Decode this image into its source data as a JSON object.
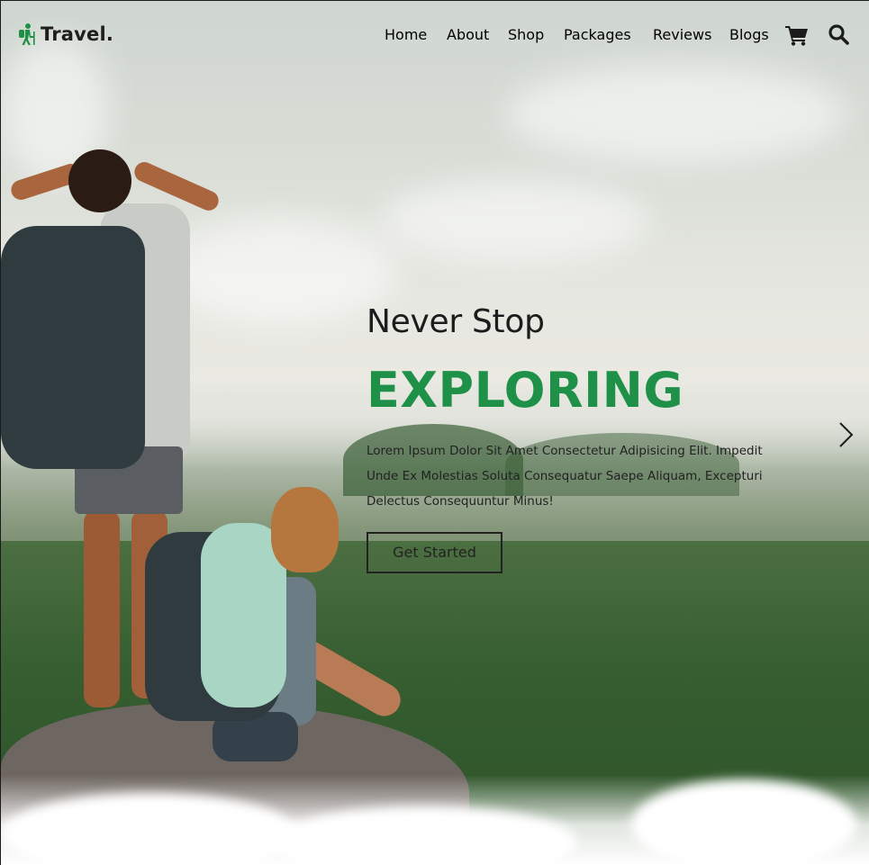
{
  "header": {
    "logo_text": "Travel.",
    "nav": [
      {
        "label": "Home"
      },
      {
        "label": "About"
      },
      {
        "label": "Shop"
      },
      {
        "label": "Packages"
      },
      {
        "label": "Reviews"
      },
      {
        "label": "Blogs"
      }
    ],
    "icons": [
      "cart-icon",
      "search-icon"
    ]
  },
  "hero": {
    "kicker": "Never Stop",
    "headline": "EXPLORING",
    "description": "Lorem Ipsum Dolor Sit Amet Consectetur Adipisicing Elit. Impedit Unde Ex Molestias Soluta Consequatur Saepe Aliquam, Excepturi Delectus Consequuntur Minus!",
    "cta_label": "Get Started",
    "slider_control_icon": "chevron-right-icon"
  },
  "colors": {
    "accent": "#1f9048",
    "text": "#1c1c1c"
  }
}
